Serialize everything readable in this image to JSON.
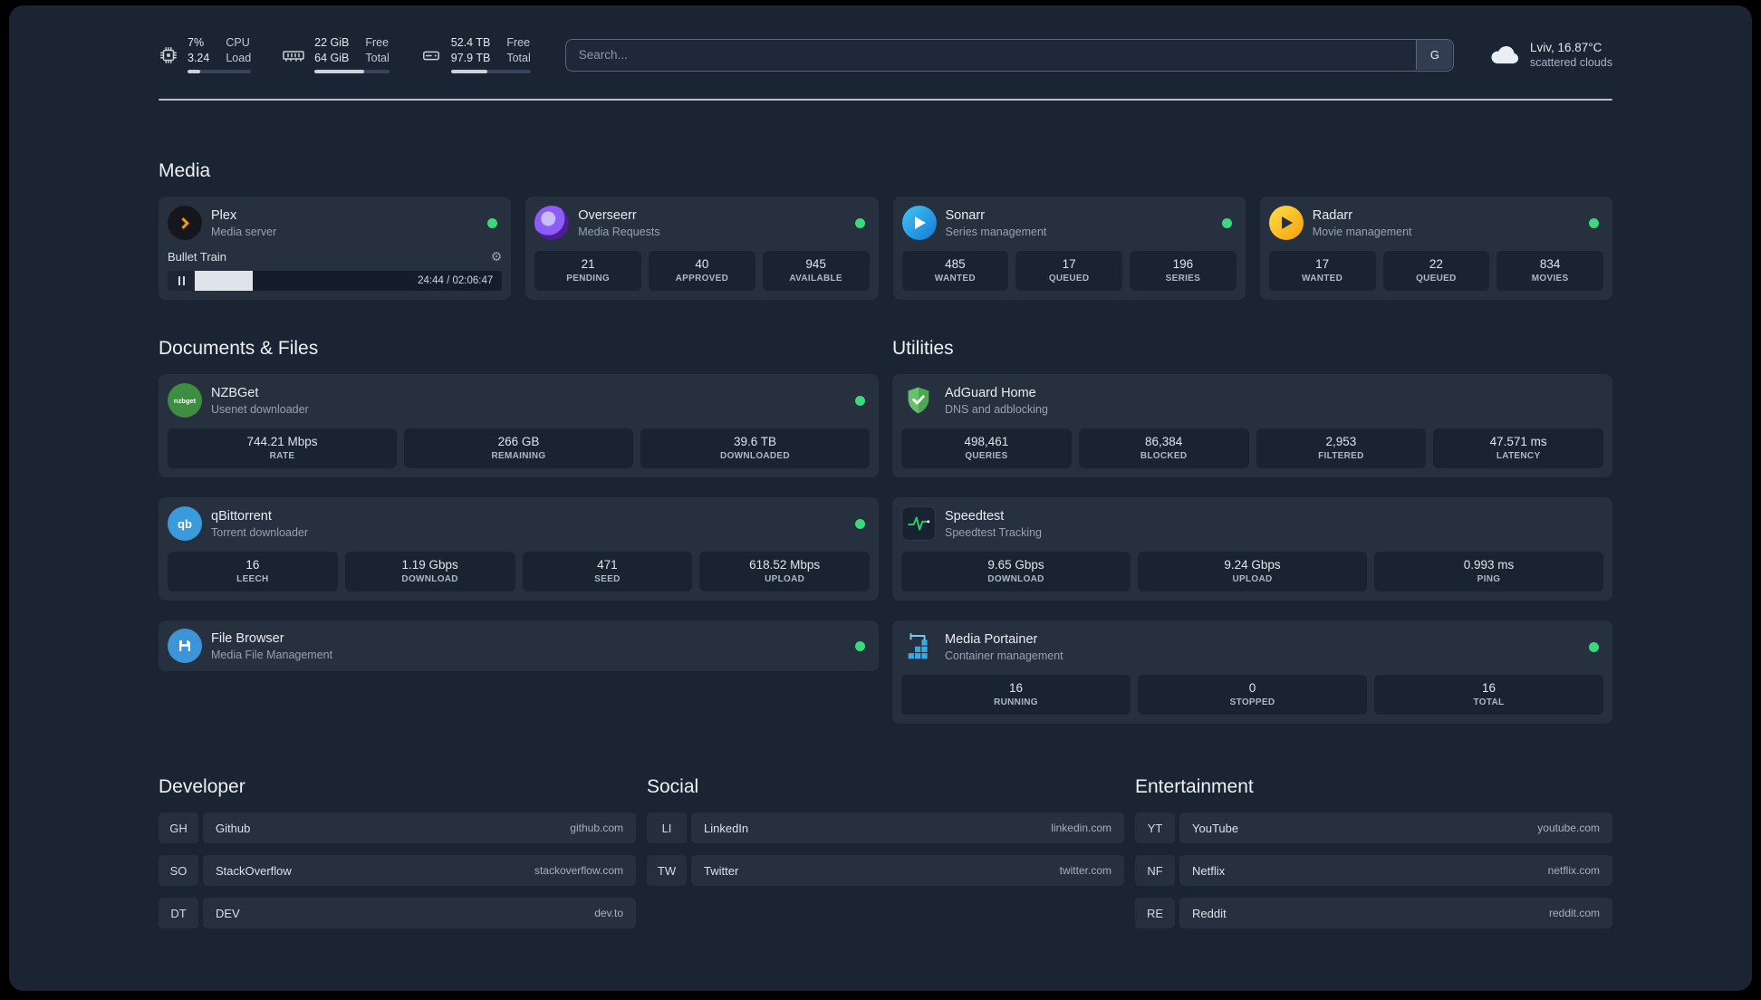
{
  "topbar": {
    "cpu": {
      "value1": "7%",
      "label1": "CPU",
      "value2": "3.24",
      "label2": "Load"
    },
    "memory": {
      "value1": "22 GiB",
      "label1": "Free",
      "value2": "64 GiB",
      "label2": "Total"
    },
    "disk": {
      "value1": "52.4 TB",
      "label1": "Free",
      "value2": "97.9 TB",
      "label2": "Total"
    },
    "search": {
      "placeholder": "Search...",
      "provider_label": "G"
    },
    "weather": {
      "location": "Lviv, 16.87°C",
      "condition": "scattered clouds"
    }
  },
  "media": {
    "title": "Media",
    "plex": {
      "name": "Plex",
      "desc": "Media server",
      "now_playing": "Bullet Train",
      "time": "24:44 / 02:06:47"
    },
    "overseerr": {
      "name": "Overseerr",
      "desc": "Media Requests",
      "stats": [
        {
          "value": "21",
          "label": "PENDING"
        },
        {
          "value": "40",
          "label": "APPROVED"
        },
        {
          "value": "945",
          "label": "AVAILABLE"
        }
      ]
    },
    "sonarr": {
      "name": "Sonarr",
      "desc": "Series management",
      "stats": [
        {
          "value": "485",
          "label": "WANTED"
        },
        {
          "value": "17",
          "label": "QUEUED"
        },
        {
          "value": "196",
          "label": "SERIES"
        }
      ]
    },
    "radarr": {
      "name": "Radarr",
      "desc": "Movie management",
      "stats": [
        {
          "value": "17",
          "label": "WANTED"
        },
        {
          "value": "22",
          "label": "QUEUED"
        },
        {
          "value": "834",
          "label": "MOVIES"
        }
      ]
    }
  },
  "documents": {
    "title": "Documents & Files",
    "nzbget": {
      "name": "NZBGet",
      "desc": "Usenet downloader",
      "icon_text": "nzbget",
      "stats": [
        {
          "value": "744.21 Mbps",
          "label": "RATE"
        },
        {
          "value": "266 GB",
          "label": "REMAINING"
        },
        {
          "value": "39.6 TB",
          "label": "DOWNLOADED"
        }
      ]
    },
    "qbittorrent": {
      "name": "qBittorrent",
      "desc": "Torrent downloader",
      "icon_text": "qb",
      "stats": [
        {
          "value": "16",
          "label": "LEECH"
        },
        {
          "value": "1.19 Gbps",
          "label": "DOWNLOAD"
        },
        {
          "value": "471",
          "label": "SEED"
        },
        {
          "value": "618.52 Mbps",
          "label": "UPLOAD"
        }
      ]
    },
    "filebrowser": {
      "name": "File Browser",
      "desc": "Media File Management"
    }
  },
  "utilities": {
    "title": "Utilities",
    "adguard": {
      "name": "AdGuard Home",
      "desc": "DNS and adblocking",
      "stats": [
        {
          "value": "498,461",
          "label": "QUERIES"
        },
        {
          "value": "86,384",
          "label": "BLOCKED"
        },
        {
          "value": "2,953",
          "label": "FILTERED"
        },
        {
          "value": "47.571 ms",
          "label": "LATENCY"
        }
      ]
    },
    "speedtest": {
      "name": "Speedtest",
      "desc": "Speedtest Tracking",
      "stats": [
        {
          "value": "9.65 Gbps",
          "label": "DOWNLOAD"
        },
        {
          "value": "9.24 Gbps",
          "label": "UPLOAD"
        },
        {
          "value": "0.993 ms",
          "label": "PING"
        }
      ]
    },
    "portainer": {
      "name": "Media Portainer",
      "desc": "Container management",
      "stats": [
        {
          "value": "16",
          "label": "RUNNING"
        },
        {
          "value": "0",
          "label": "STOPPED"
        },
        {
          "value": "16",
          "label": "TOTAL"
        }
      ]
    }
  },
  "bookmarks": {
    "developer": {
      "title": "Developer",
      "items": [
        {
          "abbr": "GH",
          "name": "Github",
          "url": "github.com"
        },
        {
          "abbr": "SO",
          "name": "StackOverflow",
          "url": "stackoverflow.com"
        },
        {
          "abbr": "DT",
          "name": "DEV",
          "url": "dev.to"
        }
      ]
    },
    "social": {
      "title": "Social",
      "items": [
        {
          "abbr": "LI",
          "name": "LinkedIn",
          "url": "linkedin.com"
        },
        {
          "abbr": "TW",
          "name": "Twitter",
          "url": "twitter.com"
        }
      ]
    },
    "entertainment": {
      "title": "Entertainment",
      "items": [
        {
          "abbr": "YT",
          "name": "YouTube",
          "url": "youtube.com"
        },
        {
          "abbr": "NF",
          "name": "Netflix",
          "url": "netflix.com"
        },
        {
          "abbr": "RE",
          "name": "Reddit",
          "url": "reddit.com"
        }
      ]
    }
  },
  "colors": {
    "status_online": "#3bd97b",
    "page_background": "#1b2433",
    "card_background": "#26303f",
    "plex_accent": "#e5a00d"
  }
}
